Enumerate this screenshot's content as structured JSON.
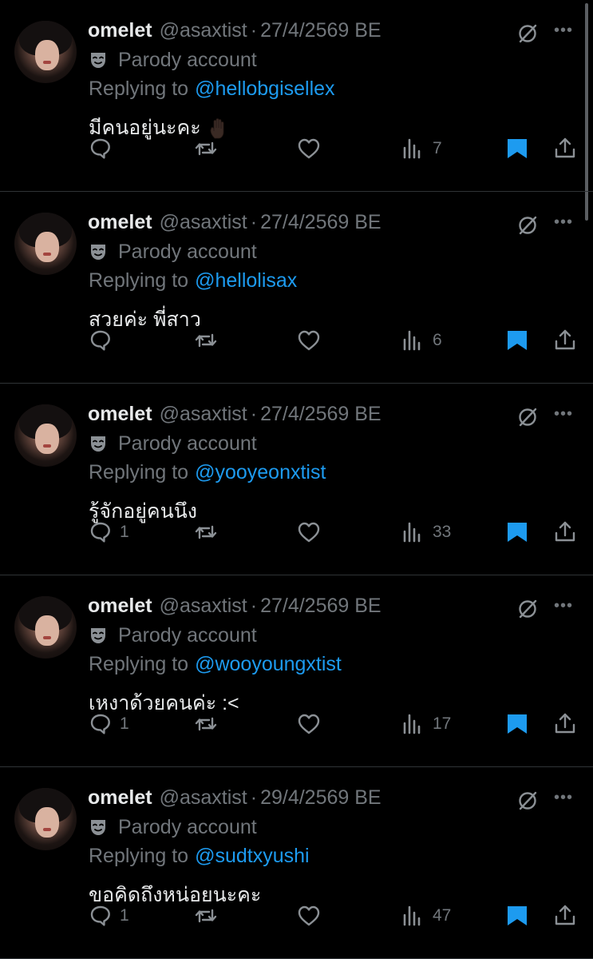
{
  "colors": {
    "background": "#000000",
    "primary_text": "#e7e9ea",
    "secondary_text": "#71767b",
    "accent": "#1d9bf0",
    "divider": "#2f3336"
  },
  "icons": {
    "reply": "speech-bubble-icon",
    "repost": "repost-arrows-icon",
    "like": "heart-icon",
    "views": "bar-chart-icon",
    "bookmark": "bookmark-filled-icon",
    "share": "share-upload-icon",
    "grok": "slashed-circle-icon",
    "more": "ellipsis-icon",
    "parody": "theater-mask-icon"
  },
  "tweets": [
    {
      "name": "omelet",
      "handle": "@asaxtist",
      "separator": "·",
      "date": "27/4/2569 BE",
      "more": "•••",
      "parody_label": "Parody account",
      "reply_prefix": "Replying to",
      "reply_handle": "@hellobgisellex",
      "text": "มีคนอยู่นะคะ",
      "emoji": "raised-hand-dark-skin",
      "replies": "",
      "views": "7",
      "bookmarked": true
    },
    {
      "name": "omelet",
      "handle": "@asaxtist",
      "separator": "·",
      "date": "27/4/2569 BE",
      "more": "•••",
      "parody_label": "Parody account",
      "reply_prefix": "Replying to",
      "reply_handle": "@hellolisax",
      "text": "สวยค่ะ พี่สาว",
      "replies": "",
      "views": "6",
      "bookmarked": true
    },
    {
      "name": "omelet",
      "handle": "@asaxtist",
      "separator": "·",
      "date": "27/4/2569 BE",
      "more": "•••",
      "parody_label": "Parody account",
      "reply_prefix": "Replying to",
      "reply_handle": "@yooyeonxtist",
      "text": "รู้จักอยู่คนนึง",
      "replies": "1",
      "views": "33",
      "bookmarked": true
    },
    {
      "name": "omelet",
      "handle": "@asaxtist",
      "separator": "·",
      "date": "27/4/2569 BE",
      "more": "•••",
      "parody_label": "Parody account",
      "reply_prefix": "Replying to",
      "reply_handle": "@wooyoungxtist",
      "text": "เหงาด้วยคนค่ะ :<",
      "replies": "1",
      "views": "17",
      "bookmarked": true
    },
    {
      "name": "omelet",
      "handle": "@asaxtist",
      "separator": "·",
      "date": "29/4/2569 BE",
      "more": "•••",
      "parody_label": "Parody account",
      "reply_prefix": "Replying to",
      "reply_handle": "@sudtxyushi",
      "text": "ขอคิดถึงหน่อยนะคะ",
      "replies": "1",
      "views": "47",
      "bookmarked": true
    }
  ]
}
